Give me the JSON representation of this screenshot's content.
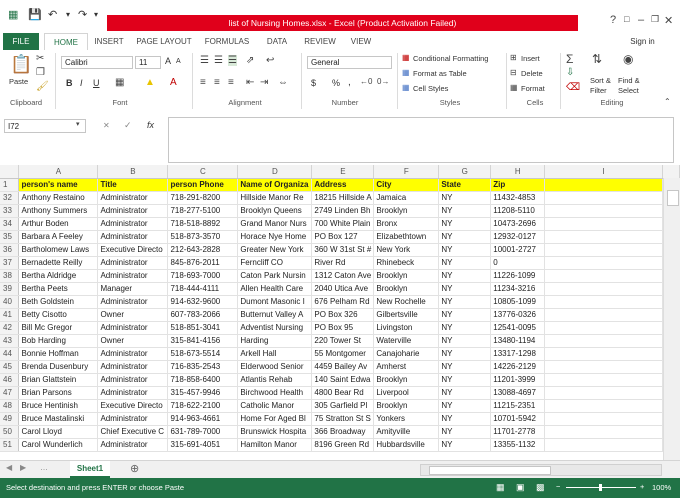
{
  "window": {
    "title": "list of Nursing Homes.xlsx - Excel (Product Activation Failed)",
    "sign_in": "Sign in",
    "help": "?",
    "minimize": "–",
    "restore": "❐",
    "close": "✕"
  },
  "tabs": [
    "FILE",
    "HOME",
    "INSERT",
    "PAGE LAYOUT",
    "FORMULAS",
    "DATA",
    "REVIEW",
    "VIEW"
  ],
  "ribbon": {
    "clipboard": {
      "paste": "Paste",
      "label": "Clipboard"
    },
    "font": {
      "name": "Calibri",
      "size": "11",
      "bold": "B",
      "italic": "I",
      "underline": "U",
      "grow": "A",
      "shrink": "A",
      "label": "Font"
    },
    "alignment": {
      "label": "Alignment"
    },
    "number": {
      "format": "General",
      "currency": "$",
      "percent": "%",
      "comma": ",",
      "label": "Number"
    },
    "styles": {
      "conditional": "Conditional Formatting",
      "table": "Format as Table",
      "cell": "Cell Styles",
      "label": "Styles"
    },
    "cells": {
      "insert": "Insert",
      "delete": "Delete",
      "format": "Format",
      "label": "Cells"
    },
    "editing": {
      "sort": "Sort &",
      "filter": "Filter",
      "find": "Find &",
      "select": "Select",
      "label": "Editing"
    }
  },
  "formula_bar": {
    "name_box": "I72",
    "cancel": "✕",
    "enter": "✓",
    "fx": "fx",
    "value": ""
  },
  "grid": {
    "columns": [
      "A",
      "B",
      "C",
      "D",
      "E",
      "F",
      "G",
      "H",
      "I"
    ],
    "header_row": {
      "num": "1",
      "cells": [
        "person's name",
        "Title",
        "person Phone",
        "Name of Organiza",
        "Address",
        "City",
        "State",
        "Zip",
        ""
      ]
    },
    "rows": [
      {
        "num": "32",
        "cells": [
          "Anthony Restaino",
          "Administrator",
          "718-291-8200",
          "Hillside Manor Re",
          "18215 Hillside A",
          "Jamaica",
          "NY",
          "11432-4853",
          ""
        ]
      },
      {
        "num": "33",
        "cells": [
          "Anthony Summers",
          "Administrator",
          "718-277-5100",
          "Brooklyn Queens",
          "2749 Linden Bh",
          "Brooklyn",
          "NY",
          "11208-5110",
          ""
        ]
      },
      {
        "num": "34",
        "cells": [
          "Arthur Boden",
          "Administrator",
          "718-518-8892",
          "Grand Manor Nurs",
          "700 White Plain",
          "Bronx",
          "NY",
          "10473-2696",
          ""
        ]
      },
      {
        "num": "35",
        "cells": [
          "Barbara A Feeley",
          "Administrator",
          "518-873-3570",
          "Horace Nye Home",
          "PO Box 127",
          "Elizabethtown",
          "NY",
          "12932-0127",
          ""
        ]
      },
      {
        "num": "36",
        "cells": [
          "Bartholomew Laws",
          "Executive Directo",
          "212-643-2828",
          "Greater New York",
          "360 W 31st St #",
          "New York",
          "NY",
          "10001-2727",
          ""
        ]
      },
      {
        "num": "37",
        "cells": [
          "Bernadette Reilly",
          "Administrator",
          "845-876-2011",
          "Ferncliff CO",
          "River Rd",
          "Rhinebeck",
          "NY",
          "0",
          ""
        ]
      },
      {
        "num": "38",
        "cells": [
          "Bertha Aldridge",
          "Administrator",
          "718-693-7000",
          "Caton Park Nursin",
          "1312 Caton Ave",
          "Brooklyn",
          "NY",
          "11226-1099",
          ""
        ]
      },
      {
        "num": "39",
        "cells": [
          "Bertha Peets",
          "Manager",
          "718-444-4111",
          "Allen Health Care",
          "2040 Utica Ave",
          "Brooklyn",
          "NY",
          "11234-3216",
          ""
        ]
      },
      {
        "num": "40",
        "cells": [
          "Beth Goldstein",
          "Administrator",
          "914-632-9600",
          "Dumont Masonic I",
          "676 Pelham Rd",
          "New Rochelle",
          "NY",
          "10805-1099",
          ""
        ]
      },
      {
        "num": "41",
        "cells": [
          "Betty Cisotto",
          "Owner",
          "607-783-2066",
          "Butternut Valley A",
          "PO Box 326",
          "Gilbertsville",
          "NY",
          "13776-0326",
          ""
        ]
      },
      {
        "num": "42",
        "cells": [
          "Bill Mc Gregor",
          "Administrator",
          "518-851-3041",
          "Adventist Nursing",
          "PO Box 95",
          "Livingston",
          "NY",
          "12541-0095",
          ""
        ]
      },
      {
        "num": "43",
        "cells": [
          "Bob Harding",
          "Owner",
          "315-841-4156",
          "Harding",
          "220 Tower St",
          "Waterville",
          "NY",
          "13480-1194",
          ""
        ]
      },
      {
        "num": "44",
        "cells": [
          "Bonnie Hoffman",
          "Administrator",
          "518-673-5514",
          "Arkell Hall",
          "55 Montgomer",
          "Canajoharie",
          "NY",
          "13317-1298",
          ""
        ]
      },
      {
        "num": "45",
        "cells": [
          "Brenda Dusenbury",
          "Administrator",
          "716-835-2543",
          "Elderwood Senior",
          "4459 Bailey Av",
          "Amherst",
          "NY",
          "14226-2129",
          ""
        ]
      },
      {
        "num": "46",
        "cells": [
          "Brian Glattstein",
          "Administrator",
          "718-858-6400",
          "Atlantis Rehab",
          "140 Saint Edwa",
          "Brooklyn",
          "NY",
          "11201-3999",
          ""
        ]
      },
      {
        "num": "47",
        "cells": [
          "Brian Parsons",
          "Administrator",
          "315-457-9946",
          "Birchwood Health",
          "4800 Bear Rd",
          "Liverpool",
          "NY",
          "13088-4697",
          ""
        ]
      },
      {
        "num": "48",
        "cells": [
          "Bruce Hentinish",
          "Executive Directo",
          "718-622-2100",
          "Catholic Manor",
          "305 Garfield Pl",
          "Brooklyn",
          "NY",
          "11215-2351",
          ""
        ]
      },
      {
        "num": "49",
        "cells": [
          "Bruce Mastalinski",
          "Administrator",
          "914-963-4661",
          "Home For Aged Bl",
          "75 Stratton St S",
          "Yonkers",
          "NY",
          "10701-5942",
          ""
        ]
      },
      {
        "num": "50",
        "cells": [
          "Carol Lloyd",
          "Chief Executive C",
          "631-789-7000",
          "Brunswick Hospita",
          "366 Broadway",
          "Amityville",
          "NY",
          "11701-2778",
          ""
        ]
      },
      {
        "num": "51",
        "cells": [
          "Carol Wunderlich",
          "Administrator",
          "315-691-4051",
          "Hamilton Manor",
          "8196 Green Rd",
          "Hubbardsville",
          "NY",
          "13355-1132",
          ""
        ]
      }
    ]
  },
  "sheets": [
    "Sheet1"
  ],
  "status": {
    "message": "Select destination and press ENTER or choose Paste",
    "zoom": "100%"
  }
}
